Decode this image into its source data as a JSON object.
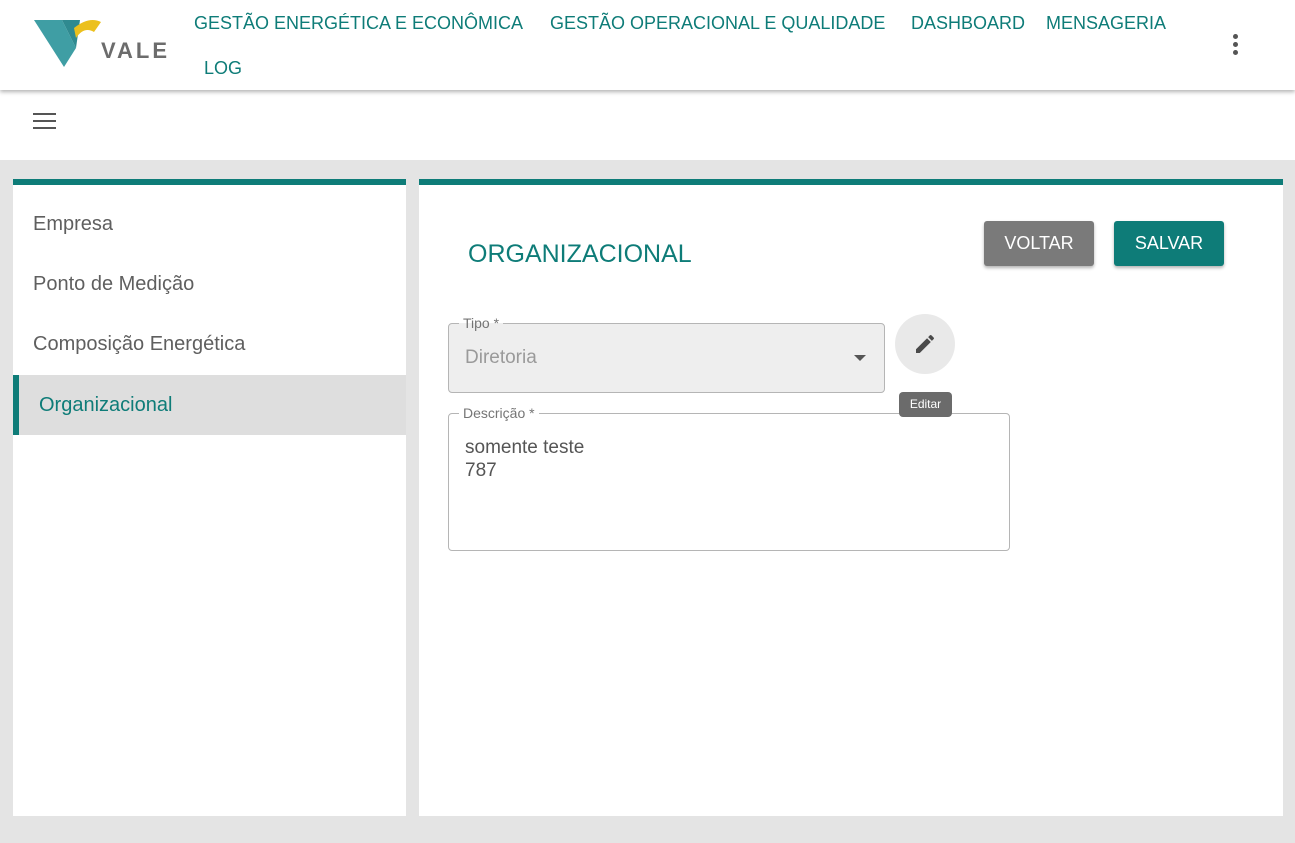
{
  "header": {
    "logo_text": "VALE",
    "nav": [
      "GESTÃO ENERGÉTICA E ECONÔMICA",
      "GESTÃO OPERACIONAL E QUALIDADE",
      "DASHBOARD",
      "MENSAGERIA",
      "LOG"
    ],
    "more_icon": "more-vert-icon",
    "brand_color": "#0e7c78"
  },
  "toolbar": {
    "menu_icon": "hamburger-menu-icon"
  },
  "sidebar": {
    "items": [
      {
        "label": "Empresa",
        "active": false
      },
      {
        "label": "Ponto de Medição",
        "active": false
      },
      {
        "label": "Composição Energética",
        "active": false
      },
      {
        "label": "Organizacional",
        "active": true
      }
    ]
  },
  "main": {
    "title": "ORGANIZACIONAL",
    "back_label": "VOLTAR",
    "save_label": "SALVAR",
    "tipo": {
      "label": "Tipo *",
      "value": "Diretoria"
    },
    "edit": {
      "icon": "pencil-icon",
      "tooltip": "Editar"
    },
    "descricao": {
      "label": "Descrição *",
      "line1": "somente teste",
      "line2": "787"
    }
  }
}
